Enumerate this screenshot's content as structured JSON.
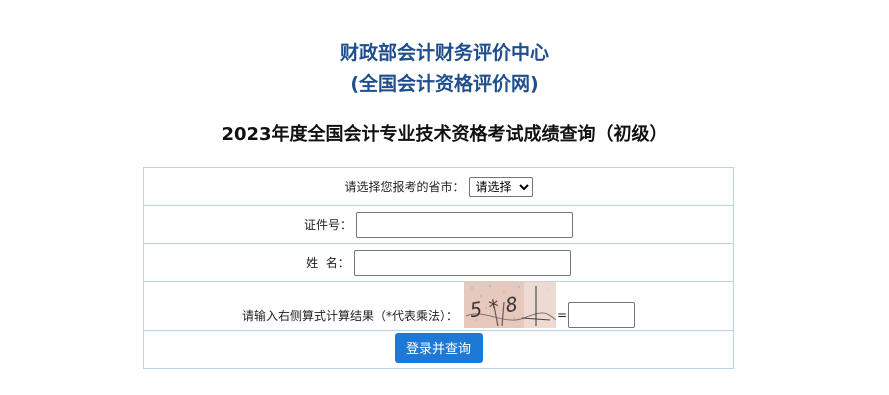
{
  "header": {
    "org_line1": "财政部会计财务评价中心",
    "org_line2": "(全国会计资格评价网)",
    "exam_title": "2023年度全国会计专业技术资格考试成绩查询（初级）"
  },
  "form": {
    "province_label": "请选择您报考的省市：",
    "province_selected": "请选择",
    "id_label": "证件号：",
    "id_value": "",
    "name_label": "姓  名：",
    "name_value": "",
    "captcha_label": "请输入右侧算式计算结果（*代表乘法）：",
    "captcha_text": "5*8",
    "equals": "=",
    "captcha_value": "",
    "submit_label": "登录并查询"
  },
  "colors": {
    "title_blue": "#1f4e8c",
    "border": "#b9d3ea",
    "button": "#1e79d6"
  }
}
